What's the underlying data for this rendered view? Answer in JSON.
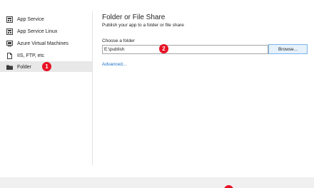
{
  "sidebar": {
    "items": [
      {
        "label": "App Service",
        "icon": "app-service-icon"
      },
      {
        "label": "App Service Linux",
        "icon": "app-service-linux-icon"
      },
      {
        "label": "Azure Virtual Machines",
        "icon": "virtual-machine-icon"
      },
      {
        "label": "IIS, FTP, etc",
        "icon": "document-icon"
      },
      {
        "label": "Folder",
        "icon": "folder-icon",
        "selected": true
      }
    ]
  },
  "main": {
    "title": "Folder or File Share",
    "subtitle": "Publish your app to a folder or file share",
    "field_label": "Choose a folder",
    "folder_value": "E:\\publish",
    "browse_label": "Browse...",
    "advanced_label": "Advanced..."
  },
  "badges": {
    "one": "1",
    "two": "2"
  },
  "colors": {
    "badge": "#e81123",
    "link": "#1a6fc7",
    "selected_bg": "#e8e8e8",
    "button_bg": "#e5f1fb",
    "button_border": "#7eb4ea"
  }
}
